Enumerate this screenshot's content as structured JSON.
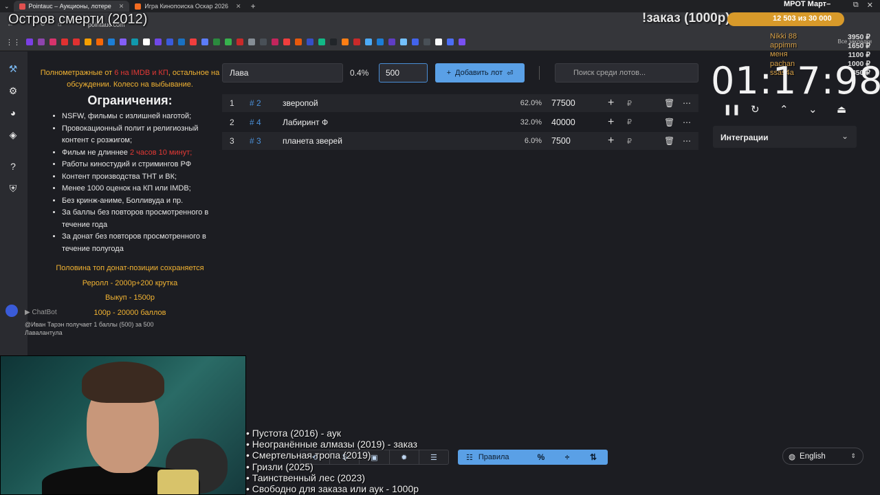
{
  "browser": {
    "tabs": [
      {
        "title": "Pointauc – Аукционы, лотере",
        "active": true,
        "favicon_color": "#e0504f"
      },
      {
        "title": "Игра Кинопоиска Оскар 2026",
        "active": false,
        "favicon_color": "#f36c21"
      }
    ],
    "url": "pointauc.com",
    "bookmark_colors": [
      "#7b3fe4",
      "#8e44ad",
      "#d6336c",
      "#e03131",
      "#e03131",
      "#f59f00",
      "#f76707",
      "#1c7ed6",
      "#845ef7",
      "#1098ad",
      "#ffffff",
      "#7048e8",
      "#3b5bdb",
      "#1971c2",
      "#f03e3e",
      "#5c7cfa",
      "#2b8a3e",
      "#37b24d",
      "#c92a2a",
      "#868e96",
      "#495057",
      "#c2255c",
      "#f03e3e",
      "#e8590c",
      "#364fc7",
      "#12b886",
      "#212529",
      "#fd7e14",
      "#c92a2a",
      "#4dabf7",
      "#1c7ed6",
      "#5f3dc4",
      "#74c0fc",
      "#4263eb",
      "#495057",
      "#f8f9fa",
      "#4c6ef5",
      "#7950f2"
    ],
    "all_bookmarks": "Все закладки"
  },
  "overlay": {
    "title": "Остров смерти (2012)",
    "order_text": "!заказ (1000р)",
    "goal_current": "12 503",
    "goal_separator": "из",
    "goal_total": "30 000",
    "mrot_text": "МРОТ Март–",
    "donors": [
      "Nikki 88",
      "appimm",
      "меня",
      "pachan",
      "ssas4a"
    ],
    "donor_amounts": [
      "3950 ₽",
      "1650 ₽",
      "1100 ₽",
      "1000 ₽",
      "850 ₽"
    ],
    "watch_list": [
      "• Пустота (2016) - аук",
      "• Неогранённые алмазы (2019) - заказ",
      "• Смертельная тропа (2019)",
      "• Гризли (2025)",
      "• Таинственный лес (2023)",
      "• Свободно для заказа или аук - 1000р"
    ]
  },
  "rules": {
    "intro_a": "Полнометражные от ",
    "intro_b": "6 на IMDB и КП",
    "intro_c": ", остальное на обсуждении. Колесо на выбывание.",
    "heading": "Ограничения:",
    "items": [
      "NSFW, фильмы с излишней наготой;",
      "Провокационный полит и религиозный контент с розжигом;",
      "Фильм не длиннее ",
      "Работы киностудий и стримингов РФ",
      "Контент производства ТНТ и ВК;",
      "Менее 1000 оценок на КП или IMDB;",
      "Без кринж-аниме, Болливуда и пр.",
      "За баллы без повторов просмотренного в течение года",
      "За донат без повторов просмотренного в течение полугода"
    ],
    "length_limit": "2 часов 10 минут;",
    "footer": [
      "Половина топ донат-позиции сохраняется",
      "Реролл - 2000р+200 крутка",
      "Выкуп - 1500р",
      "100р - 20000 баллов"
    ]
  },
  "chatbot": {
    "name": "ChatBot",
    "message": "@Иван Тарэн получает 1 баллы (500) за 500 Лавалантула"
  },
  "lot_form": {
    "name_value": "Лава",
    "percent": "0.4%",
    "amount_value": "500",
    "add_label": "Добавить лот",
    "search_placeholder": "Поиск среди лотов..."
  },
  "lots": [
    {
      "index": "1",
      "id": "# 2",
      "name": "зверопой",
      "percent": "62.0%",
      "amount": "77500"
    },
    {
      "index": "2",
      "id": "# 4",
      "name": "Лабиринт Ф",
      "percent": "32.0%",
      "amount": "40000"
    },
    {
      "index": "3",
      "id": "# 3",
      "name": "планета зверей",
      "percent": "6.0%",
      "amount": "7500"
    }
  ],
  "currency_symbol": "₽",
  "timer": {
    "value": "01:17:98"
  },
  "integrations": {
    "label": "Интеграции"
  },
  "toolbar": {
    "rules_label": "Правила"
  },
  "language": {
    "selected": "English"
  }
}
